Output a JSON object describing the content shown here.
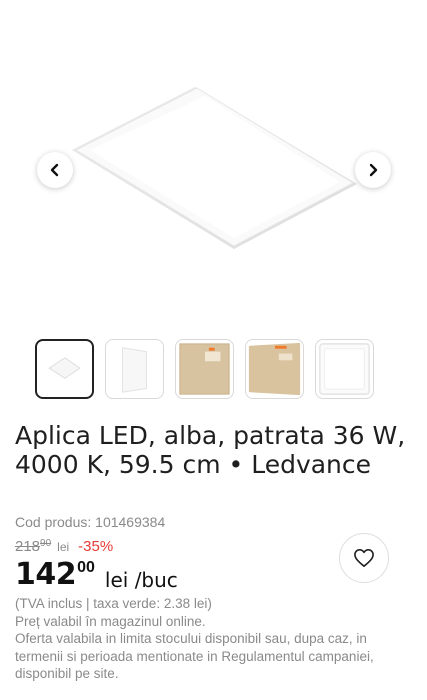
{
  "gallery": {
    "icons": {
      "prev": "chevron-left-icon",
      "next": "chevron-right-icon"
    },
    "thumbnails": [
      {
        "name": "thumb-panel-front",
        "active": true
      },
      {
        "name": "thumb-panel-side",
        "active": false
      },
      {
        "name": "thumb-box-front",
        "active": false
      },
      {
        "name": "thumb-box-angle",
        "active": false
      },
      {
        "name": "thumb-panel-back",
        "active": false
      }
    ]
  },
  "product": {
    "title": "Aplica LED, alba, patrata 36 W, 4000 K, 59.5 cm • Ledvance",
    "code": "Cod produs: 101469384",
    "old_price": {
      "int": "218",
      "dec": "90",
      "currency": "lei"
    },
    "discount": "-35%",
    "price": {
      "int": "142",
      "dec": "00",
      "unit": "lei /buc"
    },
    "notes": [
      "(TVA inclus | taxa verde: 2.38 lei)",
      "Preț valabil în magazinul online.",
      "Oferta valabila in limita stocului disponibil sau, dupa caz, in termenii si perioada mentionate in Regulamentul campaniei, disponibil pe site."
    ]
  },
  "icons": {
    "favorite": "heart-icon"
  },
  "colors": {
    "discount": "#e53935",
    "text": "#1f1f1f",
    "muted": "#8a8a8a"
  }
}
